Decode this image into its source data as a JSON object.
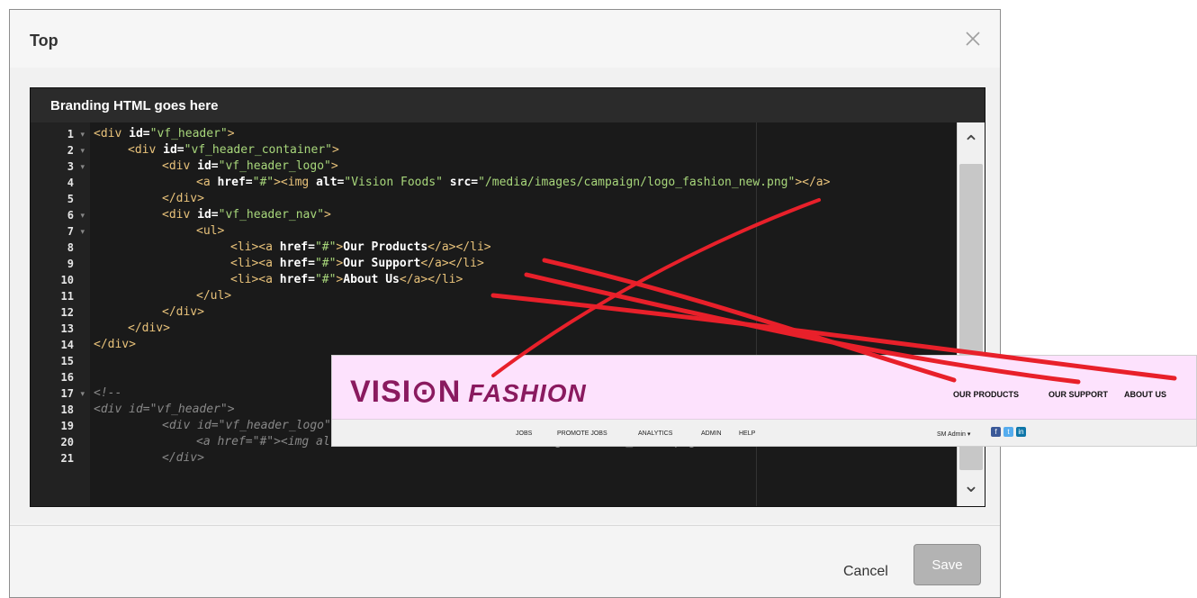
{
  "modal": {
    "title": "Top",
    "footer": {
      "cancel_label": "Cancel",
      "save_label": "Save"
    }
  },
  "editor": {
    "title": "Branding HTML goes here",
    "lines": [
      {
        "n": "1",
        "fold": true,
        "indent": 0,
        "parts": [
          [
            "tag",
            "<div "
          ],
          [
            "attr",
            "id="
          ],
          [
            "str",
            "\"vf_header\""
          ],
          [
            "tag",
            ">"
          ]
        ]
      },
      {
        "n": "2",
        "fold": true,
        "indent": 1,
        "parts": [
          [
            "tag",
            "<div "
          ],
          [
            "attr",
            "id="
          ],
          [
            "str",
            "\"vf_header_container\""
          ],
          [
            "tag",
            ">"
          ]
        ]
      },
      {
        "n": "3",
        "fold": true,
        "indent": 2,
        "parts": [
          [
            "tag",
            "<div "
          ],
          [
            "attr",
            "id="
          ],
          [
            "str",
            "\"vf_header_logo\""
          ],
          [
            "tag",
            ">"
          ]
        ]
      },
      {
        "n": "4",
        "fold": false,
        "indent": 3,
        "parts": [
          [
            "tag",
            "<a "
          ],
          [
            "attr",
            "href="
          ],
          [
            "str",
            "\"#\""
          ],
          [
            "tag",
            "><img "
          ],
          [
            "attr",
            "alt="
          ],
          [
            "str",
            "\"Vision Foods\" "
          ],
          [
            "attr",
            "src="
          ],
          [
            "str",
            "\"/media/images/campaign/logo_fashion_new.png\""
          ],
          [
            "tag",
            "></a>"
          ]
        ]
      },
      {
        "n": "5",
        "fold": false,
        "indent": 2,
        "parts": [
          [
            "tag",
            "</div>"
          ]
        ]
      },
      {
        "n": "6",
        "fold": true,
        "indent": 2,
        "parts": [
          [
            "tag",
            "<div "
          ],
          [
            "attr",
            "id="
          ],
          [
            "str",
            "\"vf_header_nav\""
          ],
          [
            "tag",
            ">"
          ]
        ]
      },
      {
        "n": "7",
        "fold": true,
        "indent": 3,
        "parts": [
          [
            "tag",
            "<ul>"
          ]
        ]
      },
      {
        "n": "8",
        "fold": false,
        "indent": 4,
        "parts": [
          [
            "tag",
            "<li><a "
          ],
          [
            "attr",
            "href="
          ],
          [
            "str",
            "\"#\""
          ],
          [
            "tag",
            ">"
          ],
          [
            "txt",
            "Our Products"
          ],
          [
            "tag",
            "</a></li>"
          ]
        ]
      },
      {
        "n": "9",
        "fold": false,
        "indent": 4,
        "parts": [
          [
            "tag",
            "<li><a "
          ],
          [
            "attr",
            "href="
          ],
          [
            "str",
            "\"#\""
          ],
          [
            "tag",
            ">"
          ],
          [
            "txt",
            "Our Support"
          ],
          [
            "tag",
            "</a></li>"
          ]
        ]
      },
      {
        "n": "10",
        "fold": false,
        "indent": 4,
        "parts": [
          [
            "tag",
            "<li><a "
          ],
          [
            "attr",
            "href="
          ],
          [
            "str",
            "\"#\""
          ],
          [
            "tag",
            ">"
          ],
          [
            "txt",
            "About Us"
          ],
          [
            "tag",
            "</a></li>"
          ]
        ]
      },
      {
        "n": "11",
        "fold": false,
        "indent": 3,
        "parts": [
          [
            "tag",
            "</ul>"
          ]
        ]
      },
      {
        "n": "12",
        "fold": false,
        "indent": 2,
        "parts": [
          [
            "tag",
            "</div>"
          ]
        ]
      },
      {
        "n": "13",
        "fold": false,
        "indent": 1,
        "parts": [
          [
            "tag",
            "</div>"
          ]
        ]
      },
      {
        "n": "14",
        "fold": false,
        "indent": 0,
        "parts": [
          [
            "tag",
            "</div>"
          ]
        ]
      },
      {
        "n": "15",
        "fold": false,
        "indent": 0,
        "parts": []
      },
      {
        "n": "16",
        "fold": false,
        "indent": 0,
        "parts": []
      },
      {
        "n": "17",
        "fold": true,
        "indent": 0,
        "parts": [
          [
            "cmt",
            "<!--"
          ]
        ]
      },
      {
        "n": "18",
        "fold": false,
        "indent": 0,
        "parts": [
          [
            "cmt",
            "<div id=\"vf_header\">"
          ]
        ]
      },
      {
        "n": "19",
        "fold": false,
        "indent": 2,
        "parts": [
          [
            "cmt",
            "<div id=\"vf_header_logo\">"
          ]
        ]
      },
      {
        "n": "20",
        "fold": false,
        "indent": 3,
        "parts": [
          [
            "cmt",
            "<a href=\"#\"><img alt=\"Vision Foods\" src=\"/media/images/vision_foods.png\"></a>"
          ]
        ]
      },
      {
        "n": "21",
        "fold": false,
        "indent": 2,
        "parts": [
          [
            "cmt",
            "</div>"
          ]
        ]
      }
    ]
  },
  "preview": {
    "logo_vision": "VISI⊙N",
    "logo_fashion": "FASHION",
    "nav": [
      "OUR PRODUCTS",
      "OUR SUPPORT",
      "ABOUT US"
    ],
    "bottom_nav": [
      "JOBS",
      "PROMOTE JOBS",
      "ANALYTICS",
      "ADMIN",
      "HELP"
    ],
    "user": "SM Admin ▾",
    "social": [
      "f",
      "t",
      "in"
    ]
  },
  "colors": {
    "arrow": "#e8202a",
    "brand": "#8a1a5f",
    "preview_bg": "#fde2fd"
  }
}
